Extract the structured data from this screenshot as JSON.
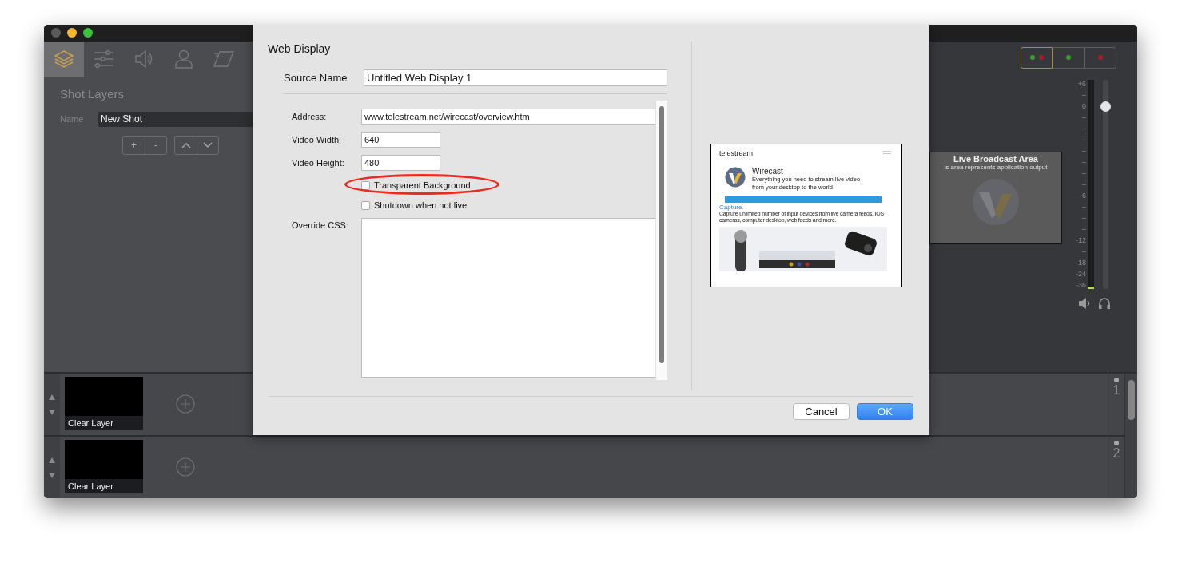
{
  "toolbar": {
    "tabs": [
      {
        "selected": true
      },
      {
        "selected": false
      },
      {
        "selected": false
      },
      {
        "selected": false
      },
      {
        "selected": false
      }
    ]
  },
  "shot_layers": {
    "title": "Shot Layers",
    "name_label": "Name",
    "name_value": "New Shot",
    "buttons": [
      "+",
      "-"
    ]
  },
  "status_buttons": [
    {
      "selected": true,
      "dots": [
        {
          "color": "#3d9a34"
        },
        {
          "color": "#a3202c"
        }
      ]
    },
    {
      "selected": false,
      "dots": [
        {
          "color": "#3d9a34"
        }
      ]
    },
    {
      "selected": false,
      "dots": [
        {
          "color": "#a3202c"
        }
      ]
    }
  ],
  "live_area": {
    "title": "Live Broadcast Area",
    "subtitle": "is area represents application output"
  },
  "audio": {
    "scale": [
      "+6",
      "–",
      "0",
      "–",
      "–",
      "–",
      "–",
      "–",
      "–",
      "–",
      "-6",
      "–",
      "–",
      "–",
      "-12",
      "–",
      "-18",
      "-24",
      "-36"
    ],
    "volume": {
      "level": 0.87
    }
  },
  "layers": [
    {
      "label": "Clear Layer",
      "number": "1"
    },
    {
      "label": "Clear Layer",
      "number": "2"
    }
  ],
  "dialog": {
    "title": "Web Display",
    "source_name_label": "Source Name",
    "source_name": "Untitled Web Display 1",
    "fields": [
      {
        "label": "Address:",
        "value": "www.telestream.net/wirecast/overview.htm",
        "kind": "wide"
      },
      {
        "label": "Video Width:",
        "value": "640",
        "kind": "short"
      },
      {
        "label": "Video Height:",
        "value": "480",
        "kind": "short"
      }
    ],
    "checkboxes": [
      {
        "label": "Transparent Background",
        "checked": false,
        "highlighted": true
      },
      {
        "label": "Shutdown when not live",
        "checked": false,
        "highlighted": false
      }
    ],
    "css_label": "Override CSS:",
    "preview": {
      "brand": "telestream",
      "product": "Wirecast",
      "tagline": [
        "Everything you need to stream live video",
        "from your desktop to the world"
      ],
      "section": "Capture.",
      "body": "Capture unlimited number of input devices from live camera feeds, IOS cameras, computer desktop, web feeds and more."
    },
    "buttons": [
      {
        "label": "Cancel",
        "default": false
      },
      {
        "label": "OK",
        "default": true
      }
    ]
  }
}
